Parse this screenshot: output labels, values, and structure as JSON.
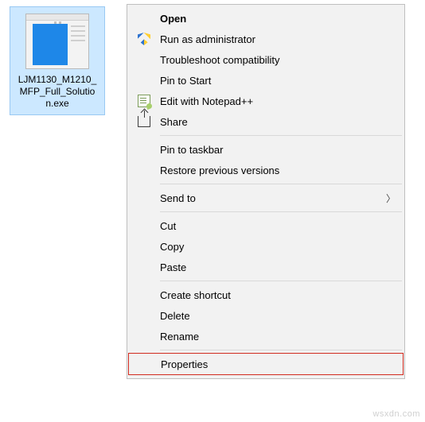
{
  "file": {
    "name_line1": "LJM1130_M1210_",
    "name_line2": "MFP_Full_Solutio",
    "name_line3": "n.exe"
  },
  "context_menu": {
    "open": "Open",
    "run_admin": "Run as administrator",
    "troubleshoot": "Troubleshoot compatibility",
    "pin_start": "Pin to Start",
    "edit_npp": "Edit with Notepad++",
    "share": "Share",
    "pin_taskbar": "Pin to taskbar",
    "restore_prev": "Restore previous versions",
    "send_to": "Send to",
    "cut": "Cut",
    "copy": "Copy",
    "paste": "Paste",
    "create_shortcut": "Create shortcut",
    "delete": "Delete",
    "rename": "Rename",
    "properties": "Properties"
  },
  "watermark": "wsxdn.com"
}
